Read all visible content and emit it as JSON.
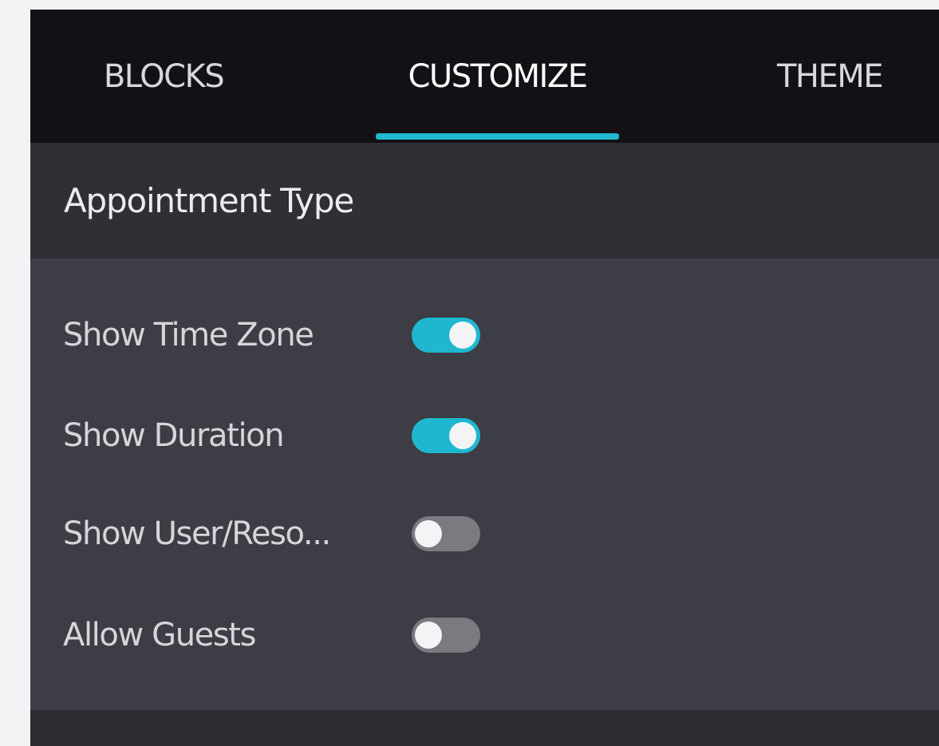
{
  "tabs": [
    {
      "label": "BLOCKS",
      "active": false
    },
    {
      "label": "CUSTOMIZE",
      "active": true
    },
    {
      "label": "THEME",
      "active": false
    }
  ],
  "section": {
    "title": "Appointment Type"
  },
  "options": [
    {
      "label": "Show Time Zone",
      "enabled": true
    },
    {
      "label": "Show Duration",
      "enabled": true
    },
    {
      "label": "Show User/Reso...",
      "enabled": false
    },
    {
      "label": "Allow Guests",
      "enabled": false
    }
  ],
  "colors": {
    "accent": "#1eb7cf",
    "tab_bar_bg": "#131116",
    "section_header_bg": "#2f2f36",
    "options_bg": "#3d3d45",
    "toggle_off": "#7a7a80"
  },
  "icons": {
    "toggle": "toggle-switch-icon"
  }
}
